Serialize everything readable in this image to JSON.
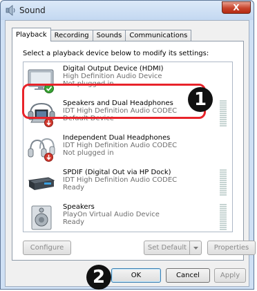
{
  "window": {
    "title": "Sound",
    "close_label": "X"
  },
  "tabs": [
    {
      "label": "Playback",
      "active": true
    },
    {
      "label": "Recording",
      "active": false
    },
    {
      "label": "Sounds",
      "active": false
    },
    {
      "label": "Communications",
      "active": false
    }
  ],
  "instruction": "Select a playback device below to modify its settings:",
  "devices": [
    {
      "name": "Digital Output Device (HDMI)",
      "driver": "High Definition Audio Device",
      "status": "Not plugged in",
      "icon": "monitor-icon",
      "badge": "green-check"
    },
    {
      "name": "Speakers and Dual Headphones",
      "driver": "IDT High Definition Audio CODEC",
      "status": "Default Device",
      "icon": "laptop-headphones-icon",
      "badge": "red-down-arrow"
    },
    {
      "name": "Independent Dual Headphones",
      "driver": "IDT High Definition Audio CODEC",
      "status": "Not plugged in",
      "icon": "headphones-icon",
      "badge": "red-down-arrow"
    },
    {
      "name": "SPDIF (Digital Out via HP Dock)",
      "driver": "IDT High Definition Audio CODEC",
      "status": "Ready",
      "icon": "dock-icon",
      "badge": ""
    },
    {
      "name": "Speakers",
      "driver": "PlayOn Virtual Audio Device",
      "status": "Ready",
      "icon": "speaker-icon",
      "badge": ""
    }
  ],
  "callouts": [
    "1",
    "2"
  ],
  "buttons": {
    "configure": "Configure",
    "set_default": "Set Default",
    "properties": "Properties",
    "ok": "OK",
    "cancel": "Cancel",
    "apply": "Apply"
  },
  "colors": {
    "highlight": "#e8232a",
    "callout": "#111111",
    "close": "#c8442c"
  }
}
